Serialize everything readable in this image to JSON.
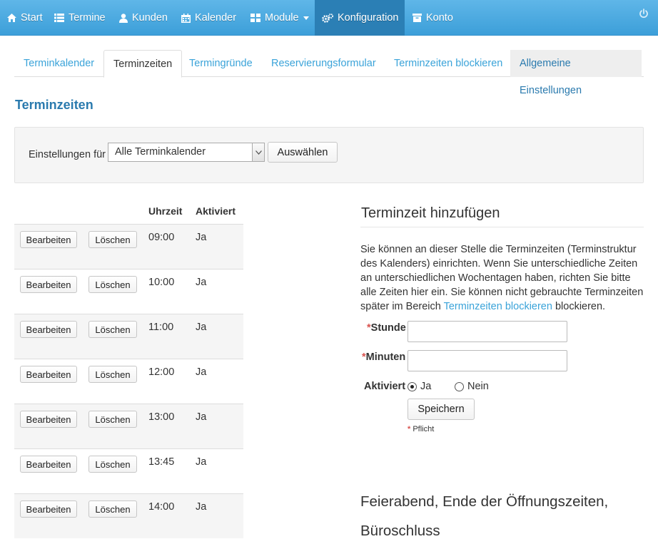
{
  "navbar": {
    "items": [
      {
        "label": "Start",
        "icon": "home-icon"
      },
      {
        "label": "Termine",
        "icon": "list-icon"
      },
      {
        "label": "Kunden",
        "icon": "user-icon"
      },
      {
        "label": "Kalender",
        "icon": "calendar-icon"
      },
      {
        "label": "Module",
        "icon": "grid-icon"
      },
      {
        "label": "Konfiguration",
        "icon": "gears-icon"
      },
      {
        "label": "Konto",
        "icon": "archive-icon"
      }
    ],
    "active": "Konfiguration",
    "power_icon": "power-icon",
    "colors": {
      "bar": "#4aaae0",
      "active": "#2b7fb5"
    }
  },
  "tabs": [
    {
      "label": "Terminkalender"
    },
    {
      "label": "Terminzeiten"
    },
    {
      "label": "Termingründe"
    },
    {
      "label": "Reservierungsformular"
    },
    {
      "label": "Terminzeiten blockieren"
    },
    {
      "label": "Allgemeine Einstellungen"
    }
  ],
  "page_title": "Terminzeiten",
  "settings": {
    "label": "Einstellungen für",
    "select_value": "Alle Terminkalender",
    "button": "Auswählen"
  },
  "table": {
    "headers": {
      "time": "Uhrzeit",
      "active": "Aktiviert"
    },
    "edit_label": "Bearbeiten",
    "delete_label": "Löschen",
    "rows": [
      {
        "time": "09:00",
        "active": "Ja"
      },
      {
        "time": "10:00",
        "active": "Ja"
      },
      {
        "time": "11:00",
        "active": "Ja"
      },
      {
        "time": "12:00",
        "active": "Ja"
      },
      {
        "time": "13:00",
        "active": "Ja"
      },
      {
        "time": "13:45",
        "active": "Ja"
      },
      {
        "time": "14:00",
        "active": "Ja"
      }
    ]
  },
  "add_form": {
    "title": "Terminzeit hinzufügen",
    "intro": "Sie können an dieser Stelle die Terminzeiten (Terminstruktur des Kalenders) einrichten. Wenn Sie unterschiedliche Zeiten an unterschiedlichen Wochentagen haben, richten Sie bitte alle Zeiten hier ein. Sie können nicht gebrauchte Terminzeiten später im Bereich",
    "intro_link": "Terminzeiten blockieren",
    "intro_end": "blockieren.",
    "required_mark": "*",
    "hour_label": "Stunde",
    "minutes_label": "Minuten",
    "hour_value": "",
    "minutes_value": "",
    "active_label": "Aktiviert",
    "option_yes": "Ja",
    "option_no": "Nein",
    "selected": "Ja",
    "save_button": "Speichern",
    "required_note": "Pflicht"
  },
  "closing_section": {
    "title_line1": "Feierabend, Ende der Öffnungszeiten,",
    "title_line2": "Büroschluss"
  }
}
